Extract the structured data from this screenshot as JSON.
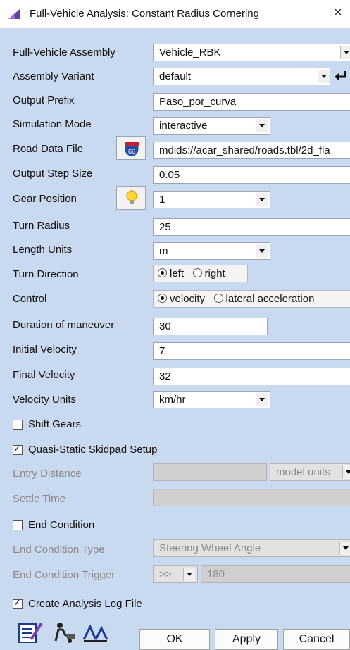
{
  "window": {
    "title": "Full-Vehicle Analysis: Constant Radius Cornering",
    "close_symbol": "×"
  },
  "fields": {
    "assembly": {
      "label": "Full-Vehicle Assembly",
      "value": "Vehicle_RBK"
    },
    "variant": {
      "label": "Assembly Variant",
      "value": "default"
    },
    "output_prefix": {
      "label": "Output Prefix",
      "value": "Paso_por_curva"
    },
    "sim_mode": {
      "label": "Simulation Mode",
      "value": "interactive"
    },
    "road_file": {
      "label": "Road Data File",
      "value": "mdids://acar_shared/roads.tbl/2d_fla"
    },
    "step_size": {
      "label": "Output Step Size",
      "value": "0.05"
    },
    "gear": {
      "label": "Gear Position",
      "value": "1"
    },
    "turn_radius": {
      "label": "Turn Radius",
      "value": "25"
    },
    "length_units": {
      "label": "Length Units",
      "value": "m"
    },
    "turn_direction": {
      "label": "Turn Direction",
      "options": [
        "left",
        "right"
      ],
      "selected": "left"
    },
    "control": {
      "label": "Control",
      "options": [
        "velocity",
        "lateral acceleration"
      ],
      "selected": "velocity"
    },
    "duration": {
      "label": "Duration of maneuver",
      "value": "30"
    },
    "initial_velocity": {
      "label": "Initial Velocity",
      "value": "7"
    },
    "final_velocity": {
      "label": "Final Velocity",
      "value": "32"
    },
    "velocity_units": {
      "label": "Velocity Units",
      "value": "km/hr"
    },
    "entry_distance": {
      "label": "Entry Distance",
      "value": "",
      "units": "model units"
    },
    "settle_time": {
      "label": "Settle Time",
      "value": ""
    },
    "end_type": {
      "label": "End Condition Type",
      "value": "Steering Wheel Angle"
    },
    "end_trigger": {
      "label": "End Condition Trigger",
      "operator": ">>",
      "value": "180"
    }
  },
  "checkboxes": {
    "shift_gears": {
      "label": "Shift Gears",
      "checked": false
    },
    "skidpad": {
      "label": "Quasi-Static Skidpad Setup",
      "checked": true
    },
    "end_condition": {
      "label": "End Condition",
      "checked": false
    },
    "log_file": {
      "label": "Create Analysis Log File",
      "checked": true
    }
  },
  "buttons": {
    "ok": "OK",
    "apply": "Apply",
    "cancel": "Cancel"
  },
  "icons": {
    "app": "adams-car-icon",
    "road": "road-shield-icon",
    "gear": "lightbulb-icon",
    "tool1": "edit-notes-icon",
    "tool2": "vehicle-setup-icon",
    "tool3": "road-tool-icon"
  }
}
